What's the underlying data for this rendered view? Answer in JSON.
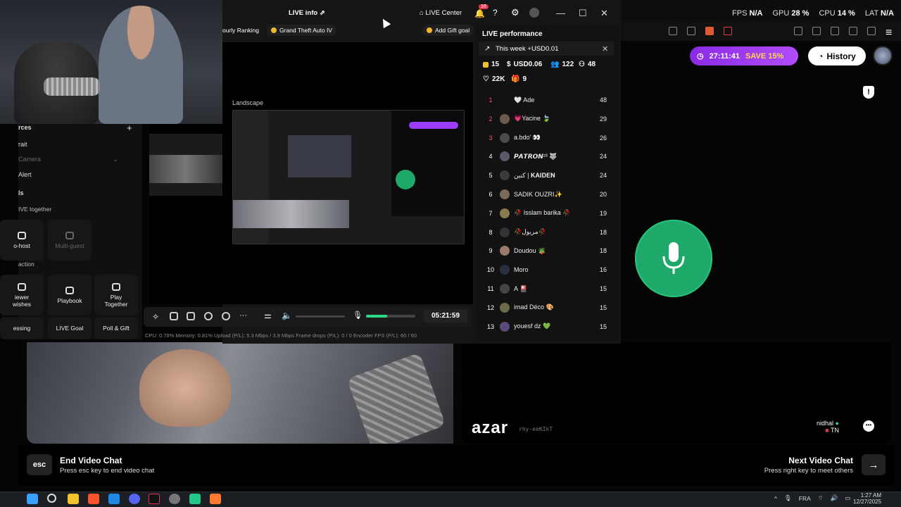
{
  "browser_stats": {
    "fps_label": "FPS",
    "fps_value": "N/A",
    "gpu_label": "GPU",
    "gpu_value": "28 %",
    "cpu_label": "CPU",
    "cpu_value": "14 %",
    "lat_label": "LAT",
    "lat_value": "N/A"
  },
  "azar": {
    "timer": "27:11:41",
    "save": "SAVE 15%",
    "history": "History",
    "logo": "azar",
    "session_id": "rhy-eeKIkT",
    "user_name": "nidhal",
    "user_country": "TN",
    "footer": {
      "esc_key": "esc",
      "end_title": "End Video Chat",
      "end_sub": "Press esc key to end video chat",
      "next_title": "Next Video Chat",
      "next_sub": "Press right key to meet others"
    }
  },
  "studio": {
    "live_info": "LIVE info",
    "live_center": "LIVE Center",
    "notif_count": "16",
    "chips": [
      "ourly Ranking",
      "Grand Theft Auto IV"
    ],
    "add_gift_goal": "Add Gift goal",
    "landscape": "Landscape",
    "timer": "05:21:59",
    "status": "CPU: 0.78%     Memory: 0.81%     Upload (P/L): 5.3 Mbps / 3.9 Mbps     Frame drops (P/L): 0 / 0     Encoder FPS (P/L): 60 / 60",
    "mic_level": 0.42,
    "left_panel": {
      "sources": "rces",
      "portrait": "rait",
      "camera": "Camera",
      "alert": "Alert",
      "section_ls": "ls",
      "live_together": "IVE together",
      "co_host": "o-host",
      "multi_guest": "Multi-guest",
      "interaction": "action",
      "viewer_wishes": "iewer\nwishes",
      "playbook": "Playbook",
      "play_together": "Play\nTogether",
      "guessing": "essing",
      "live_goal": "LIVE Goal",
      "poll_gift": "Poll & Gift"
    }
  },
  "performance": {
    "title": "LIVE performance",
    "week": "This week +USD0.01",
    "stats": {
      "diamonds": "15",
      "usd": "USD0.06",
      "viewers": "122",
      "new_followers": "48",
      "likes": "22K",
      "gifters": "9"
    },
    "ranking": [
      {
        "rank": "1",
        "name": "🤍 Ade",
        "score": "48",
        "color": "#111"
      },
      {
        "rank": "2",
        "name": "💗Yacine 🍃",
        "score": "29",
        "color": "#6b5a4e"
      },
      {
        "rank": "3",
        "name": "a.bdo' 👀",
        "score": "26",
        "color": "#4a4a4a"
      },
      {
        "rank": "4",
        "name": "𝙋𝘼𝙏𝙍𝙊𝙉²³ 🐺",
        "score": "24",
        "color": "#5a5a66"
      },
      {
        "rank": "5",
        "name": "كنين | 𝐊𝐀𝐈𝐃𝐄𝐍",
        "score": "24",
        "color": "#3a3a3a"
      },
      {
        "rank": "6",
        "name": "SADIK OUZRI✨",
        "score": "20",
        "color": "#7a6a5a"
      },
      {
        "rank": "7",
        "name": "🥀 Isslam barika 🥀",
        "score": "19",
        "color": "#8a7a50"
      },
      {
        "rank": "8",
        "name": "🥀مريول🥀",
        "score": "18",
        "color": "#333"
      },
      {
        "rank": "9",
        "name": "Doudou 🪴",
        "score": "18",
        "color": "#9a7a6a"
      },
      {
        "rank": "10",
        "name": "Moro",
        "score": "16",
        "color": "#2a3040"
      },
      {
        "rank": "11",
        "name": "A 🎴",
        "score": "15",
        "color": "#444"
      },
      {
        "rank": "12",
        "name": "imad Déco 🎨",
        "score": "15",
        "color": "#6a6a4a"
      },
      {
        "rank": "13",
        "name": "youesf dz 💚",
        "score": "15",
        "color": "#5a4a7a"
      }
    ]
  },
  "taskbar": {
    "lang": "FRA",
    "time": "1:27 AM",
    "date": "12/27/2025"
  },
  "colors": {
    "accent_green": "#1ea86a",
    "azar_purple": "#8a2be2",
    "notif_red": "#e8344e"
  }
}
